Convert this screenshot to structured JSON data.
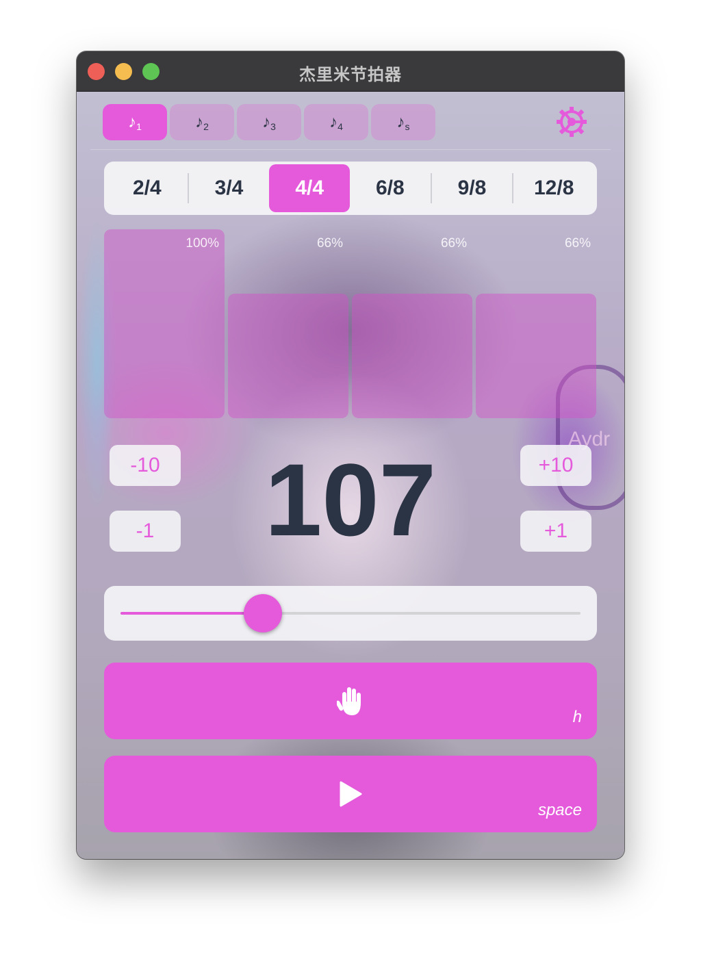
{
  "window": {
    "title": "杰里米节拍器"
  },
  "tabs": [
    {
      "label": "♪",
      "sub": "1",
      "active": true
    },
    {
      "label": "♪",
      "sub": "2",
      "active": false
    },
    {
      "label": "♪",
      "sub": "3",
      "active": false
    },
    {
      "label": "♪",
      "sub": "4",
      "active": false
    },
    {
      "label": "♪",
      "sub": "s",
      "active": false
    }
  ],
  "settings_icon": "gear-icon",
  "time_signatures": {
    "options": [
      "2/4",
      "3/4",
      "4/4",
      "6/8",
      "9/8",
      "12/8"
    ],
    "selected": "4/4"
  },
  "beats": [
    {
      "label": "100%",
      "level": 100
    },
    {
      "label": "66%",
      "level": 66
    },
    {
      "label": "66%",
      "level": 66
    },
    {
      "label": "66%",
      "level": 66
    }
  ],
  "bpm": {
    "value": "107",
    "minus10": "-10",
    "minus1": "-1",
    "plus10": "+10",
    "plus1": "+1"
  },
  "slider": {
    "fraction": 0.31
  },
  "tap_button": {
    "icon": "hand-icon",
    "shortcut": "h"
  },
  "play_button": {
    "icon": "play-icon",
    "shortcut": "space"
  },
  "art_text": "Aydr",
  "colors": {
    "accent": "#e45adb",
    "text": "#2b3444"
  }
}
